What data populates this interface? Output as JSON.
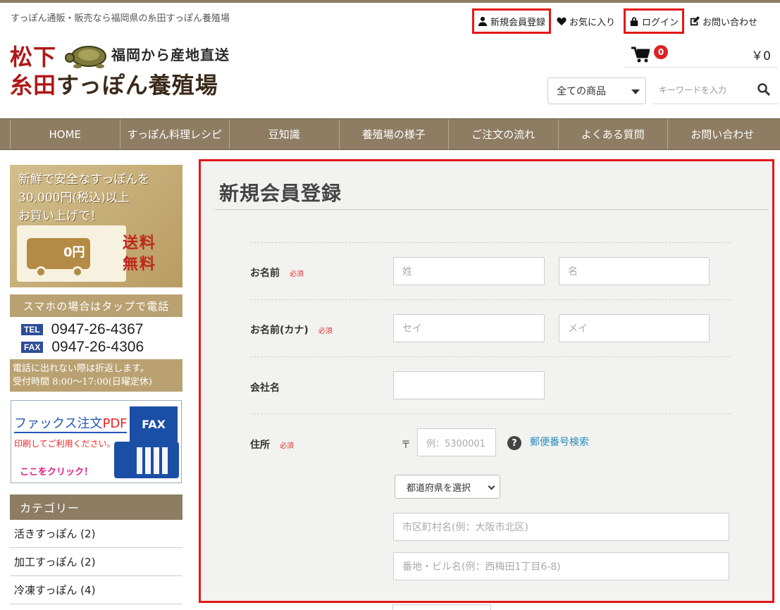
{
  "header": {
    "tagline": "すっぽん通販・販売なら福岡県の糸田すっぽん養殖場",
    "links": [
      {
        "label": "新規会員登録",
        "icon": "user-icon"
      },
      {
        "label": "お気に入り",
        "icon": "heart-icon"
      },
      {
        "label": "ログイン",
        "icon": "lock-icon"
      },
      {
        "label": "お問い合わせ",
        "icon": "edit-icon"
      }
    ],
    "logo": {
      "line1": "松下",
      "line2_red": "糸田",
      "line2": "すっぽん養殖場",
      "sub": "福岡から産地直送"
    },
    "cart": {
      "count": "0",
      "total": "￥0"
    },
    "category_select": "全ての商品",
    "search_placeholder": "キーワードを入力"
  },
  "nav": [
    "HOME",
    "すっぽん料理レシピ",
    "豆知識",
    "養殖場の様子",
    "ご注文の流れ",
    "よくある質問",
    "お問い合わせ"
  ],
  "sidebar": {
    "banner_shipping": {
      "text_lines": [
        "新鮮で安全なすっぽんを",
        "30,000円(税込)以上",
        "お買い上げで！"
      ],
      "truck_label": "0円",
      "free_lines": [
        "送料",
        "無料"
      ]
    },
    "banner_phone": {
      "header": "スマホの場合はタップで電話",
      "tel_label": "TEL",
      "tel": "0947-26-4367",
      "fax_label": "FAX",
      "fax": "0947-26-4306",
      "foot_lines": [
        "電話に出れない際は折返します。",
        "受付時間 8:00〜17:00(日曜定休)"
      ]
    },
    "banner_fax": {
      "title": "ファックス注文",
      "title_pdf": "PDF",
      "sub": "印刷してご利用ください。",
      "click": "ここをクリック！",
      "fax_label": "FAX"
    },
    "category_header": "カテゴリー",
    "categories": [
      "活きすっぽん (2)",
      "加工すっぽん (2)",
      "冷凍すっぽん (4)"
    ]
  },
  "form": {
    "title": "新規会員登録",
    "required_label": "必須",
    "name": {
      "label": "お名前",
      "last_placeholder": "姓",
      "first_placeholder": "名"
    },
    "kana": {
      "label": "お名前(カナ)",
      "last_placeholder": "セイ",
      "first_placeholder": "メイ"
    },
    "company": {
      "label": "会社名"
    },
    "address": {
      "label": "住所",
      "zip_mark": "〒",
      "zip_placeholder": "例：5300001",
      "zip_search": "郵便番号検索",
      "pref_select": "都道府県を選択",
      "city_placeholder": "市区町村名(例：大阪市北区)",
      "street_placeholder": "番地・ビル名(例：西梅田1丁目6-8)"
    }
  }
}
